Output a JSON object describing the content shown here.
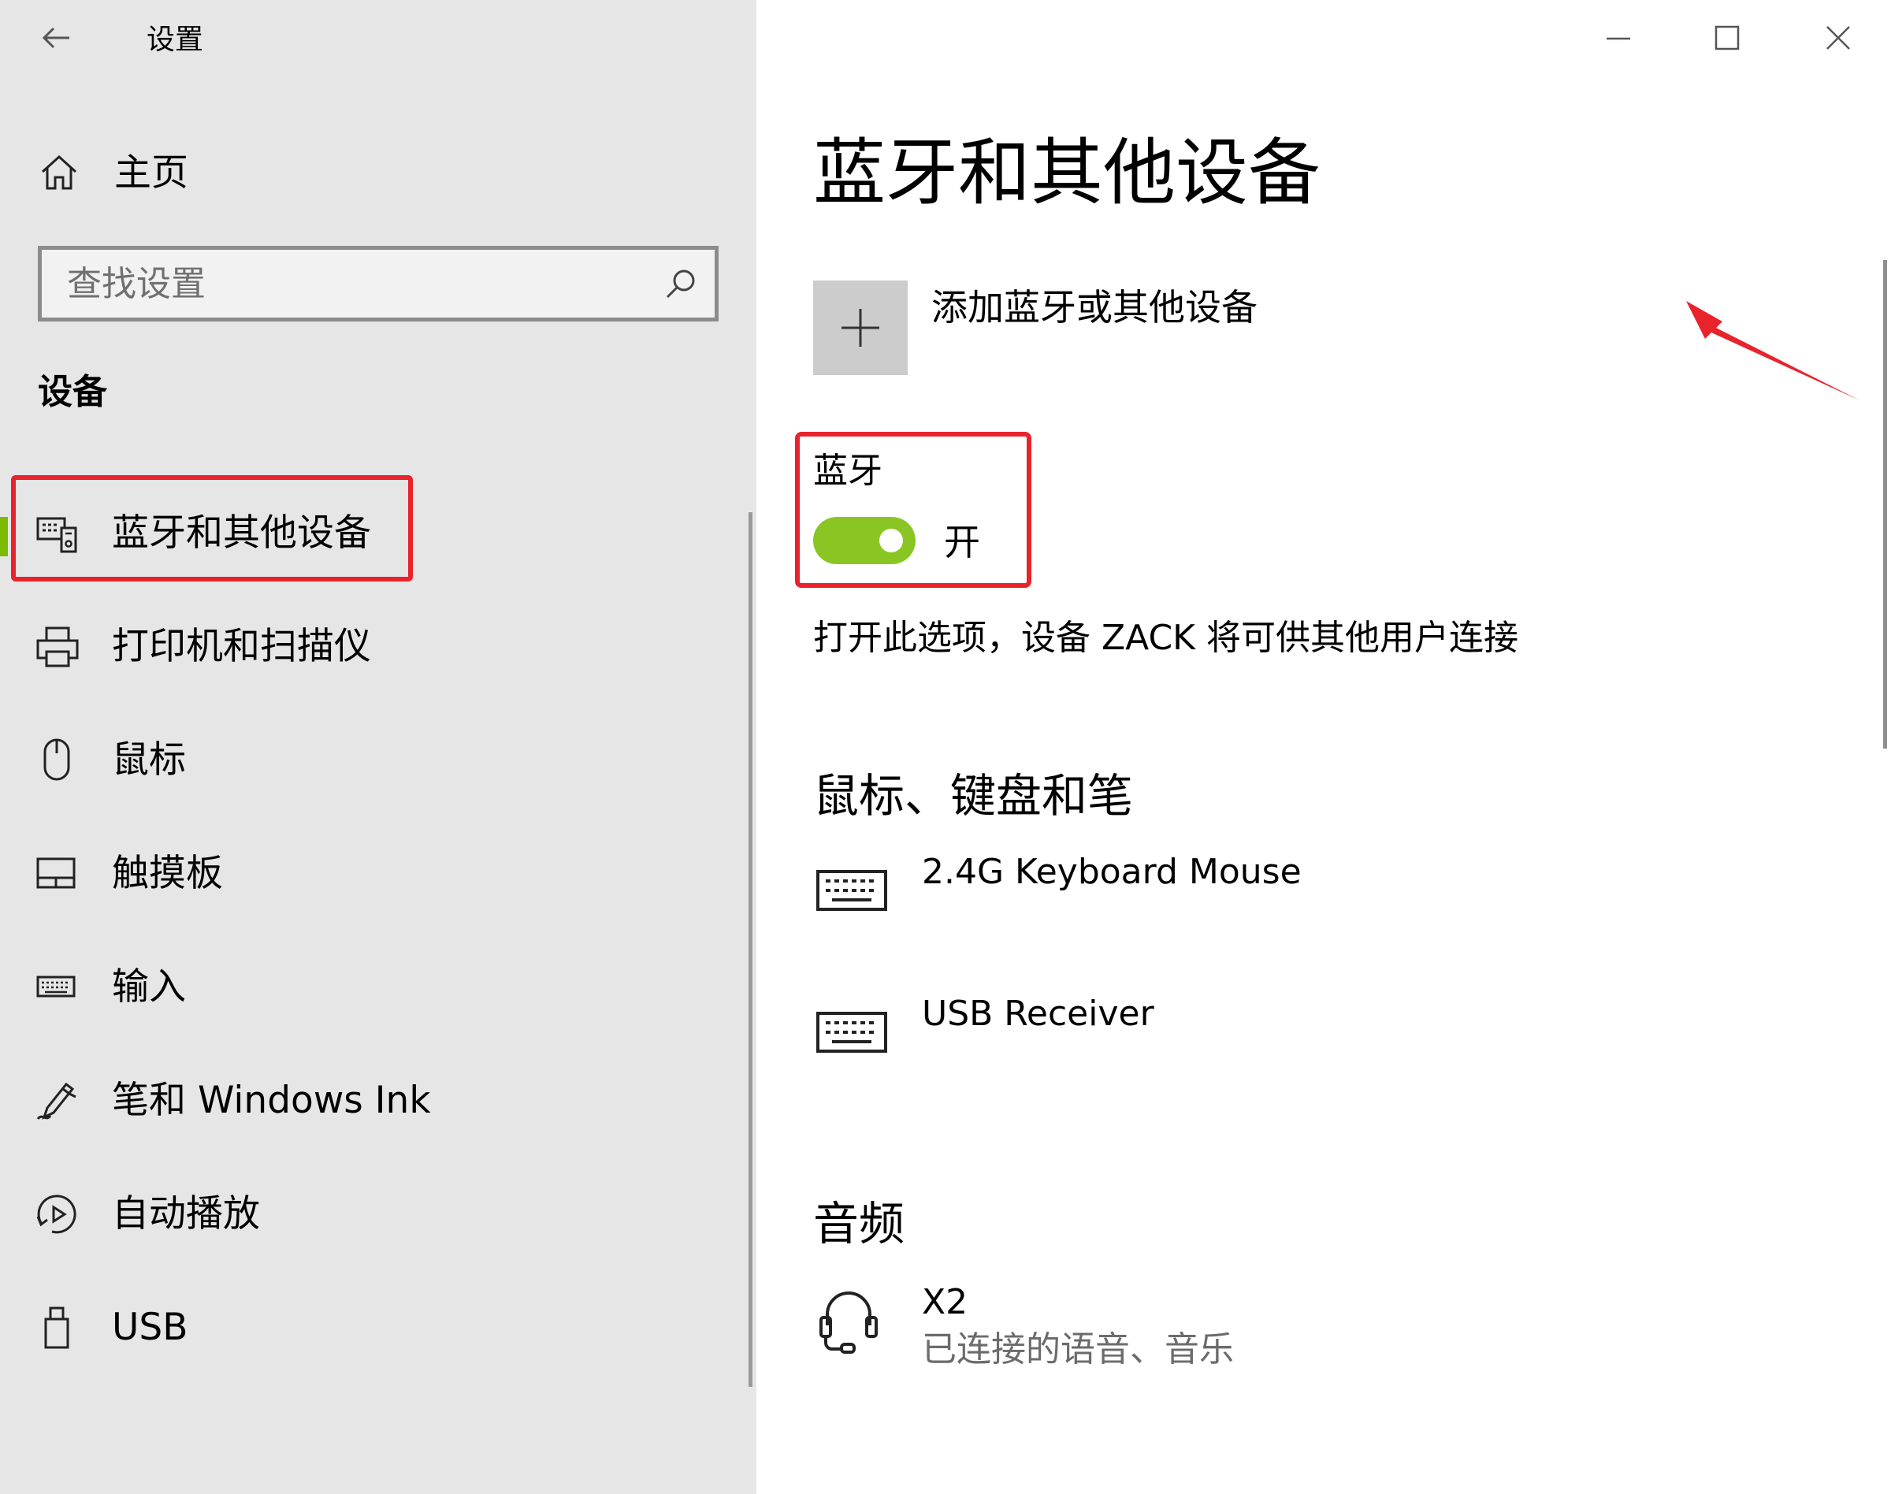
{
  "app": {
    "title": "设置"
  },
  "sidebar": {
    "home_label": "主页",
    "search": {
      "placeholder": "查找设置"
    },
    "section_title": "设备",
    "items": [
      {
        "label": "蓝牙和其他设备",
        "icon": "bluetooth-devices-icon",
        "active": true
      },
      {
        "label": "打印机和扫描仪",
        "icon": "printer-icon",
        "active": false
      },
      {
        "label": "鼠标",
        "icon": "mouse-icon",
        "active": false
      },
      {
        "label": "触摸板",
        "icon": "touchpad-icon",
        "active": false
      },
      {
        "label": "输入",
        "icon": "keyboard-icon",
        "active": false
      },
      {
        "label": "笔和 Windows Ink",
        "icon": "pen-icon",
        "active": false
      },
      {
        "label": "自动播放",
        "icon": "autoplay-icon",
        "active": false
      },
      {
        "label": "USB",
        "icon": "usb-icon",
        "active": false
      }
    ]
  },
  "main": {
    "page_title": "蓝牙和其他设备",
    "add_device_label": "添加蓝牙或其他设备",
    "bluetooth": {
      "label": "蓝牙",
      "state": "开",
      "on": true,
      "description": "打开此选项，设备 ZACK 将可供其他用户连接"
    },
    "groups": [
      {
        "heading": "鼠标、键盘和笔",
        "devices": [
          {
            "name": "2.4G Keyboard Mouse",
            "status": "",
            "icon": "keyboard-icon"
          },
          {
            "name": "USB Receiver",
            "status": "",
            "icon": "keyboard-icon"
          }
        ]
      },
      {
        "heading": "音频",
        "devices": [
          {
            "name": "X2",
            "status": "已连接的语音、音乐",
            "icon": "headset-icon"
          }
        ]
      }
    ]
  },
  "colors": {
    "accent_green": "#7cbb00",
    "toggle_on": "#8ac623",
    "annotation_red": "#e8232c",
    "sidebar_bg": "#e6e6e6"
  }
}
